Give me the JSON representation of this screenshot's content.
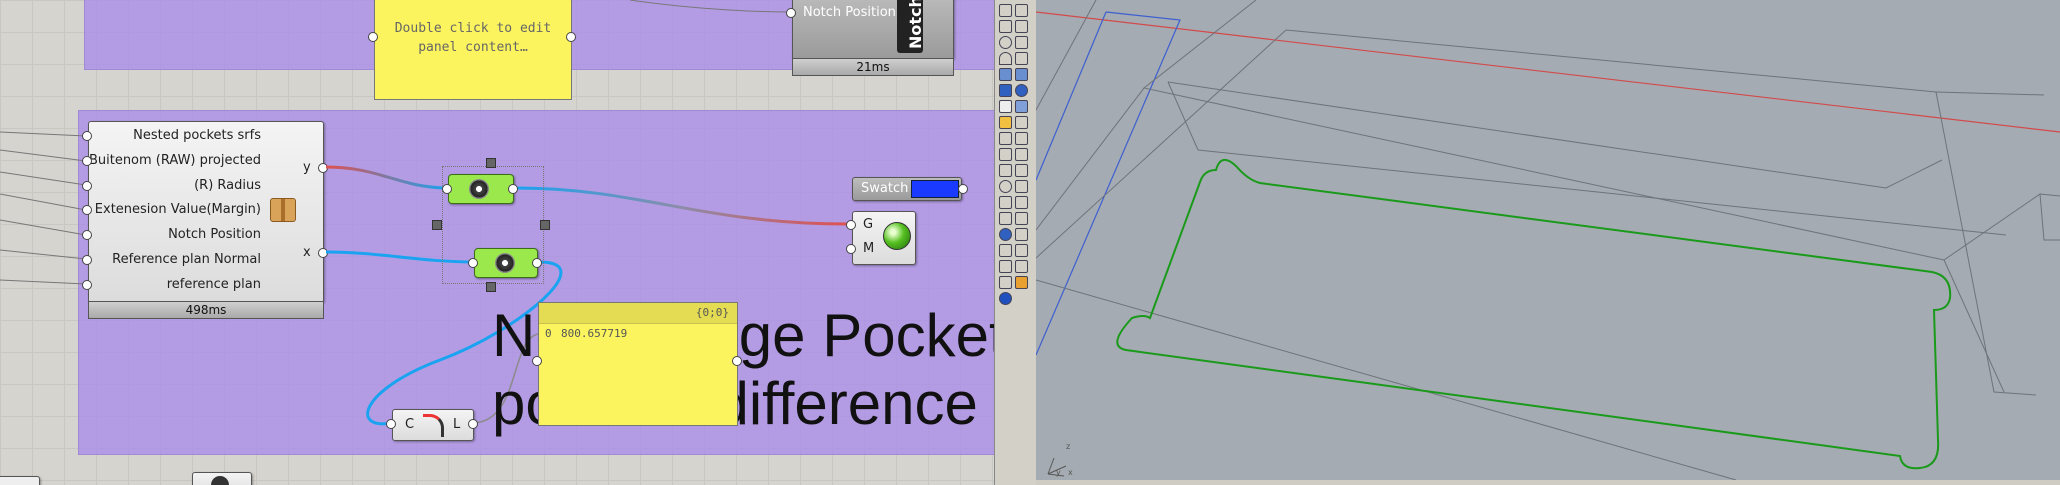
{
  "top_panel": {
    "text": "Double click to edit\npanel content…"
  },
  "top_right_component": {
    "output_label": "Notch Position",
    "side_label": "Notch",
    "timer": "21ms"
  },
  "main_component": {
    "inputs": [
      "Nested pockets srfs",
      "Buitenom  (RAW) projected",
      "(R) Radius",
      "Extenesion Value(Margin)",
      "Notch Position",
      "Reference plan Normal",
      "reference plan"
    ],
    "outputs": [
      "y",
      "x"
    ],
    "timer": "498ms"
  },
  "swatch": {
    "label": "Swatch",
    "color": "#1a3bff"
  },
  "preview": {
    "inputs": [
      "G",
      "M"
    ]
  },
  "curve_component": {
    "inputs": [
      "C"
    ],
    "outputs": [
      "L"
    ]
  },
  "value_panel": {
    "header": "{0;0}",
    "index": "0",
    "value": "800.657719"
  },
  "group_text": {
    "line1": "Notch Edge Pocket",
    "line2": "position difference"
  },
  "viewport": {
    "axis_x": "x",
    "axis_y": "y",
    "axis_z": "z"
  },
  "colors": {
    "group": "#b49ee8",
    "wire_blue": "#1aa3f0",
    "wire_red": "#e05050",
    "panel_yellow": "#fbf45e",
    "component_green": "#9be84d",
    "viewport_bg": "#a5abb2",
    "curve_green": "#1a9a1a"
  }
}
